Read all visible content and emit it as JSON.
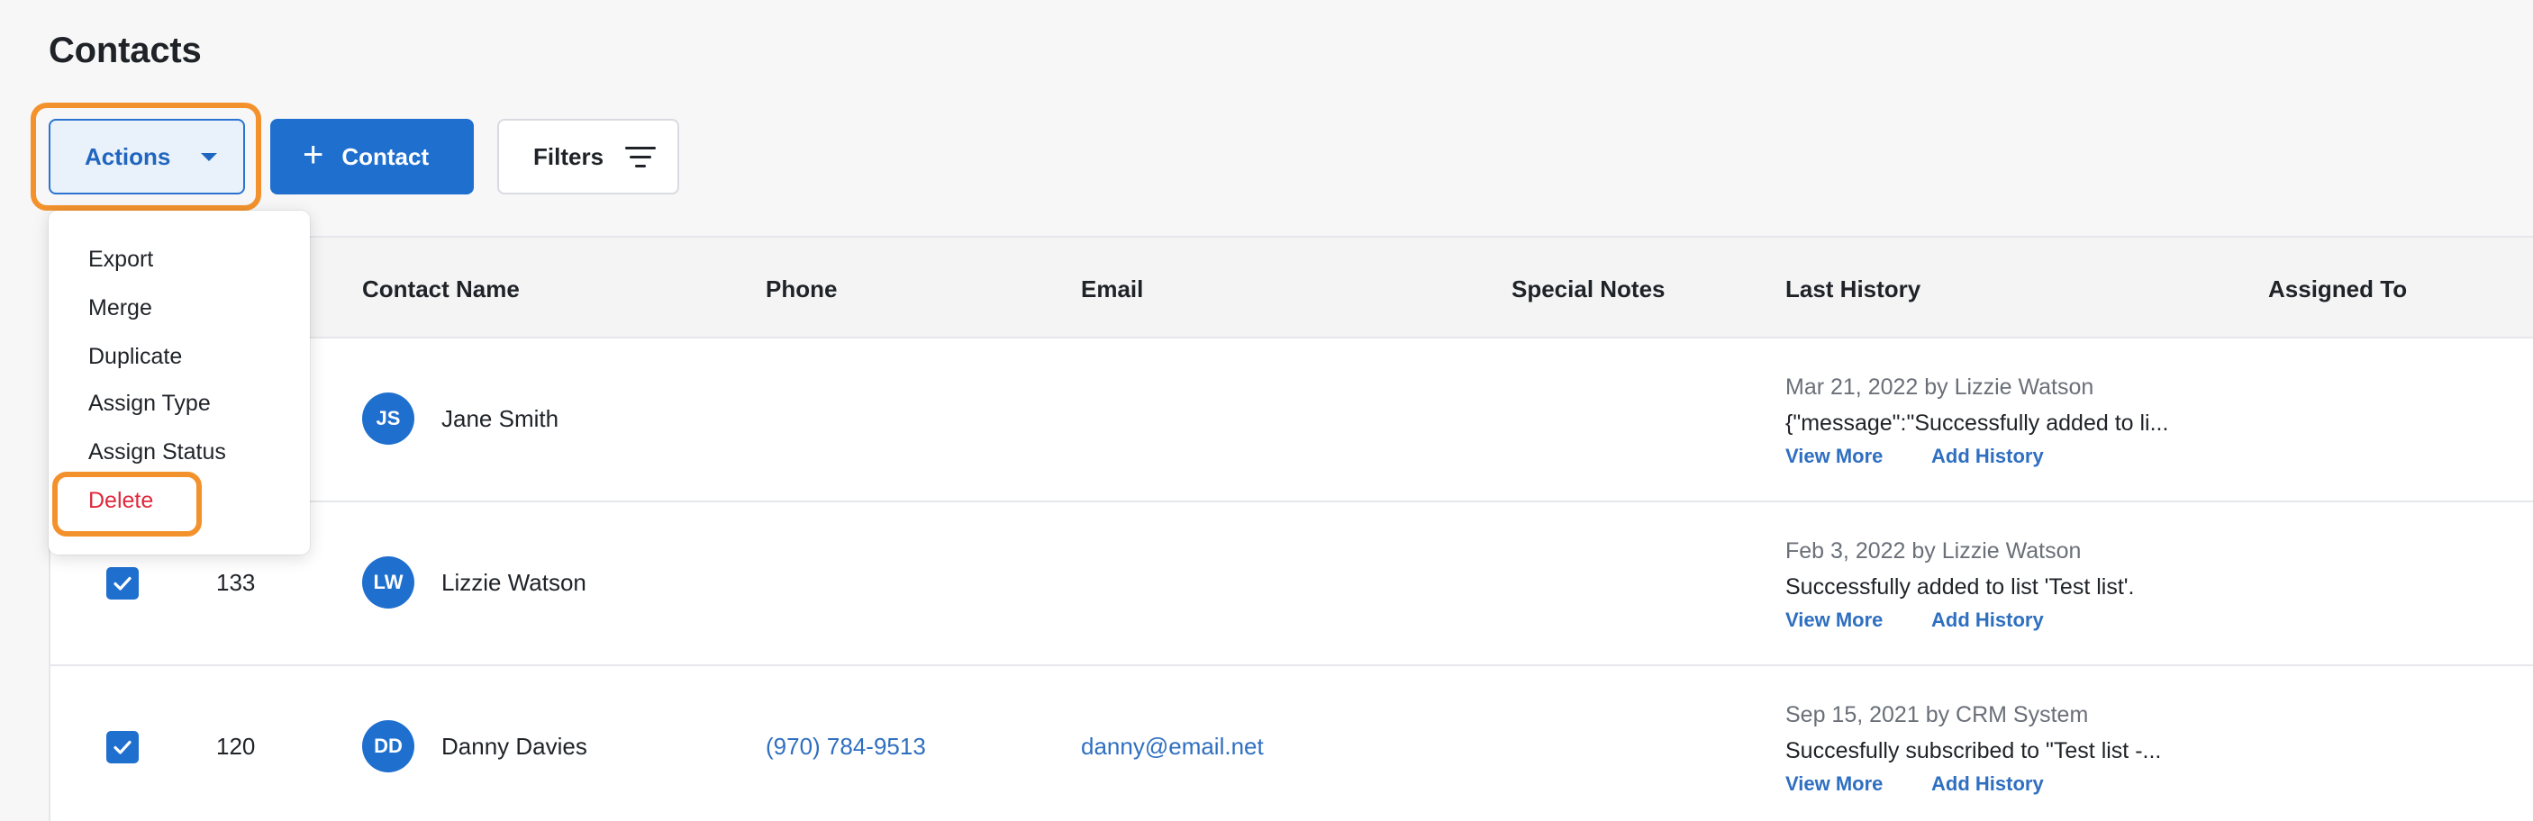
{
  "page": {
    "title": "Contacts"
  },
  "toolbar": {
    "actions_label": "Actions",
    "contact_label": "Contact",
    "filters_label": "Filters"
  },
  "actions_menu": {
    "items": [
      "Export",
      "Merge",
      "Duplicate",
      "Assign Type",
      "Assign Status",
      "Delete"
    ]
  },
  "table": {
    "columns": [
      "Contact Name",
      "Phone",
      "Email",
      "Special Notes",
      "Last History",
      "Assigned To"
    ],
    "rows": [
      {
        "id": "",
        "checked": false,
        "initials": "JS",
        "name": "Jane Smith",
        "phone": "",
        "email": "",
        "history_meta": "Mar 21, 2022 by Lizzie Watson",
        "history_message": "{\"message\":\"Successfully added to li...",
        "view_more": "View More",
        "add_history": "Add History"
      },
      {
        "id": "133",
        "checked": true,
        "initials": "LW",
        "name": "Lizzie Watson",
        "phone": "",
        "email": "",
        "history_meta": "Feb 3, 2022 by Lizzie Watson",
        "history_message": "Successfully added to list 'Test list'.",
        "view_more": "View More",
        "add_history": "Add History"
      },
      {
        "id": "120",
        "checked": true,
        "initials": "DD",
        "name": "Danny Davies",
        "phone": "(970) 784-9513",
        "email": "danny@email.net",
        "history_meta": "Sep 15, 2021 by CRM System",
        "history_message": "Succesfully subscribed to \"Test list -...",
        "view_more": "View More",
        "add_history": "Add History"
      }
    ]
  },
  "colors": {
    "primary": "#1f6fcf",
    "link": "#2f6fc0",
    "danger": "#e0283c",
    "highlight": "#f3922d"
  },
  "icons": [
    "chevron-down-icon",
    "plus-icon",
    "filter-icon",
    "check-icon"
  ]
}
